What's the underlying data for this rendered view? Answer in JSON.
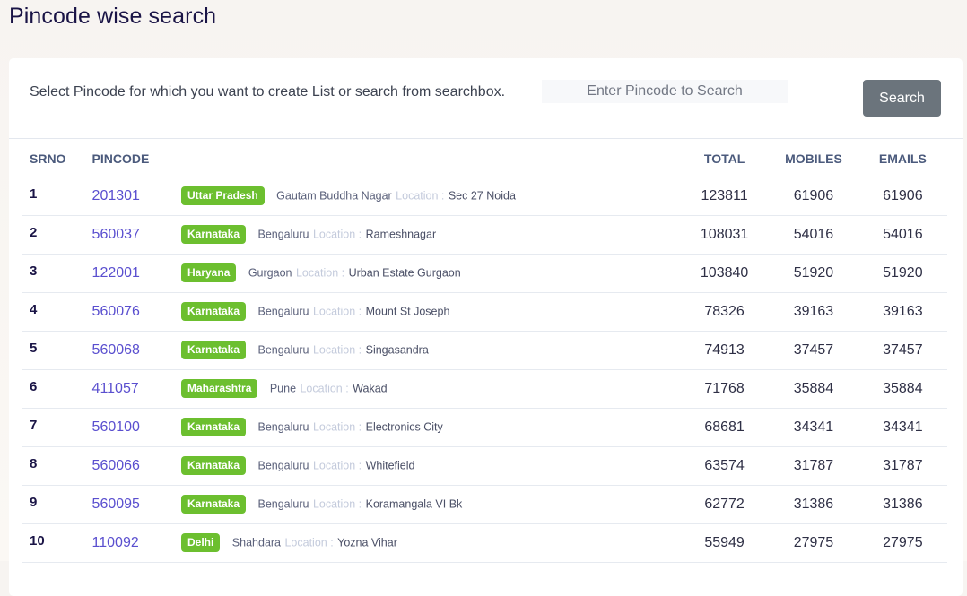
{
  "page": {
    "title": "Pincode wise search"
  },
  "search": {
    "description": "Select Pincode for which you want to create List or search from searchbox.",
    "placeholder": "Enter Pincode to Search",
    "value": "",
    "button_label": "Search"
  },
  "colors": {
    "badge": "#6cbf2f",
    "pincode_link": "#5a4fcf",
    "search_button": "#6b747c"
  },
  "table": {
    "headers": {
      "srno": "SRNO",
      "pincode": "PINCODE",
      "total": "TOTAL",
      "mobiles": "MOBILES",
      "emails": "EMAILS"
    },
    "location_label": "Location :",
    "rows": [
      {
        "srno": "1",
        "pincode": "201301",
        "state": "Uttar Pradesh",
        "district": "Gautam Buddha Nagar",
        "locality": "Sec 27 Noida",
        "total": "123811",
        "mobiles": "61906",
        "emails": "61906"
      },
      {
        "srno": "2",
        "pincode": "560037",
        "state": "Karnataka",
        "district": "Bengaluru",
        "locality": "Rameshnagar",
        "total": "108031",
        "mobiles": "54016",
        "emails": "54016"
      },
      {
        "srno": "3",
        "pincode": "122001",
        "state": "Haryana",
        "district": "Gurgaon",
        "locality": "Urban Estate Gurgaon",
        "total": "103840",
        "mobiles": "51920",
        "emails": "51920"
      },
      {
        "srno": "4",
        "pincode": "560076",
        "state": "Karnataka",
        "district": "Bengaluru",
        "locality": "Mount St Joseph",
        "total": "78326",
        "mobiles": "39163",
        "emails": "39163"
      },
      {
        "srno": "5",
        "pincode": "560068",
        "state": "Karnataka",
        "district": "Bengaluru",
        "locality": "Singasandra",
        "total": "74913",
        "mobiles": "37457",
        "emails": "37457"
      },
      {
        "srno": "6",
        "pincode": "411057",
        "state": "Maharashtra",
        "district": "Pune",
        "locality": "Wakad",
        "total": "71768",
        "mobiles": "35884",
        "emails": "35884"
      },
      {
        "srno": "7",
        "pincode": "560100",
        "state": "Karnataka",
        "district": "Bengaluru",
        "locality": "Electronics City",
        "total": "68681",
        "mobiles": "34341",
        "emails": "34341"
      },
      {
        "srno": "8",
        "pincode": "560066",
        "state": "Karnataka",
        "district": "Bengaluru",
        "locality": "Whitefield",
        "total": "63574",
        "mobiles": "31787",
        "emails": "31787"
      },
      {
        "srno": "9",
        "pincode": "560095",
        "state": "Karnataka",
        "district": "Bengaluru",
        "locality": "Koramangala VI Bk",
        "total": "62772",
        "mobiles": "31386",
        "emails": "31386"
      },
      {
        "srno": "10",
        "pincode": "110092",
        "state": "Delhi",
        "district": "Shahdara",
        "locality": "Yozna Vihar",
        "total": "55949",
        "mobiles": "27975",
        "emails": "27975"
      }
    ]
  }
}
